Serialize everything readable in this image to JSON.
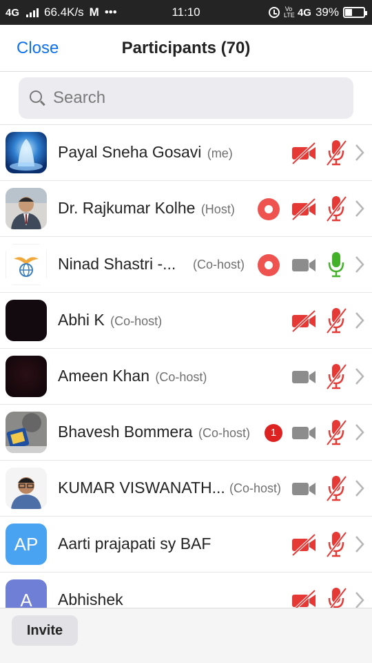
{
  "status_bar": {
    "network": "4G",
    "speed": "66.4K/s",
    "mail_icon": "M",
    "more": "•••",
    "time": "11:10",
    "volte": "Vo LTE",
    "network2": "4G",
    "battery": "39%",
    "battery_level": 0.39
  },
  "header": {
    "close_label": "Close",
    "title": "Participants (70)"
  },
  "search": {
    "placeholder": "Search"
  },
  "participants": [
    {
      "name": "Payal Sneha Gosavi",
      "role": "(me)",
      "avatar": "photo-water",
      "recording": false,
      "unread": null,
      "video": "off",
      "mic": "muted"
    },
    {
      "name": "Dr. Rajkumar Kolhe",
      "role": "(Host)",
      "avatar": "photo-man-suit",
      "recording": true,
      "unread": null,
      "video": "off",
      "mic": "muted"
    },
    {
      "name": "Ninad Shastri -...",
      "role": "(Co-host)",
      "avatar": "logo-wings-globe",
      "recording": true,
      "unread": null,
      "video": "available",
      "mic": "active"
    },
    {
      "name": "Abhi K",
      "role": "(Co-host)",
      "avatar": "photo-dark",
      "recording": false,
      "unread": null,
      "video": "off",
      "mic": "muted"
    },
    {
      "name": "Ameen Khan",
      "role": "(Co-host)",
      "avatar": "photo-dark-red",
      "recording": false,
      "unread": null,
      "video": "available",
      "mic": "muted"
    },
    {
      "name": "Bhavesh Bommera",
      "role": "(Co-host)",
      "avatar": "photo-device",
      "recording": false,
      "unread": "1",
      "video": "available",
      "mic": "muted"
    },
    {
      "name": "KUMAR VISWANATH...",
      "role": "(Co-host)",
      "avatar": "photo-man-glasses",
      "recording": false,
      "unread": null,
      "video": "available",
      "mic": "muted"
    },
    {
      "name": "Aarti prajapati sy BAF",
      "role": "",
      "avatar": "initials",
      "initials": "AP",
      "avatar_color": "#4aa3f0",
      "recording": false,
      "unread": null,
      "video": "off",
      "mic": "muted"
    },
    {
      "name": "Abhishek",
      "role": "",
      "avatar": "initials",
      "initials": "A",
      "avatar_color": "#6f7fd6",
      "recording": false,
      "unread": null,
      "video": "off",
      "mic": "muted"
    }
  ],
  "footer": {
    "invite_label": "Invite"
  },
  "colors": {
    "accent": "#0e71eb",
    "muted_red": "#e53935",
    "unmuted_green": "#43b02a",
    "icon_gray": "#8c8c8c",
    "recording": "#ef5350"
  }
}
